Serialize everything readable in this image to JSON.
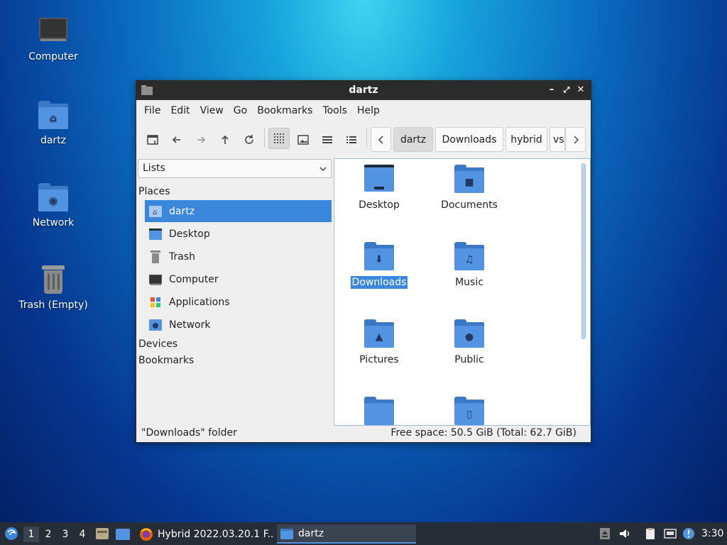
{
  "desktop": {
    "icons": [
      {
        "label": "Computer",
        "icon": "computer-icon"
      },
      {
        "label": "dartz",
        "icon": "home-folder-icon"
      },
      {
        "label": "Network",
        "icon": "network-folder-icon"
      },
      {
        "label": "Trash (Empty)",
        "icon": "trash-icon"
      }
    ]
  },
  "window": {
    "title": "dartz",
    "controls": {
      "minimize": "minimize-icon",
      "maximize": "maximize-icon",
      "close": "close-icon"
    },
    "menu": [
      "File",
      "Edit",
      "View",
      "Go",
      "Bookmarks",
      "Tools",
      "Help"
    ],
    "toolbar": {
      "buttons": [
        "new-window-icon",
        "back-icon",
        "forward-icon",
        "up-icon",
        "reload-icon",
        "icon-view-icon",
        "thumbnail-view-icon",
        "compact-view-icon",
        "detailed-list-icon"
      ]
    },
    "path": [
      "dartz",
      "Downloads",
      "hybrid",
      "vs"
    ],
    "sidebar": {
      "combo_value": "Lists",
      "places_label": "Places",
      "places": [
        {
          "label": "dartz",
          "icon": "home-folder-icon"
        },
        {
          "label": "Desktop",
          "icon": "desktop-icon"
        },
        {
          "label": "Trash",
          "icon": "trash-icon"
        },
        {
          "label": "Computer",
          "icon": "computer-icon"
        },
        {
          "label": "Applications",
          "icon": "applications-icon"
        },
        {
          "label": "Network",
          "icon": "network-folder-icon"
        }
      ],
      "devices_label": "Devices",
      "bookmarks_label": "Bookmarks"
    },
    "files": [
      {
        "label": "Desktop",
        "icon": "desktop-folder-icon"
      },
      {
        "label": "Documents",
        "icon": "documents-folder-icon"
      },
      {
        "label": "Downloads",
        "icon": "downloads-folder-icon",
        "selected": true
      },
      {
        "label": "Music",
        "icon": "music-folder-icon"
      },
      {
        "label": "Pictures",
        "icon": "pictures-folder-icon"
      },
      {
        "label": "Public",
        "icon": "public-folder-icon"
      },
      {
        "label": "",
        "icon": "folder-icon"
      },
      {
        "label": "",
        "icon": "templates-folder-icon"
      }
    ],
    "status_left": "\"Downloads\" folder",
    "status_right": "Free space: 50.5 GiB (Total: 62.7 GiB)"
  },
  "taskbar": {
    "workspaces": [
      "1",
      "2",
      "3",
      "4"
    ],
    "tasks": [
      {
        "label": "Hybrid 2022.03.20.1 F...",
        "icon": "firefox-icon"
      },
      {
        "label": "dartz",
        "icon": "folder-icon"
      }
    ],
    "clock": "3:30"
  },
  "colors": {
    "accent": "#3b87dc",
    "folder": "#5294e2",
    "titlebar": "#2b2b2b",
    "taskbar": "#262d36"
  }
}
